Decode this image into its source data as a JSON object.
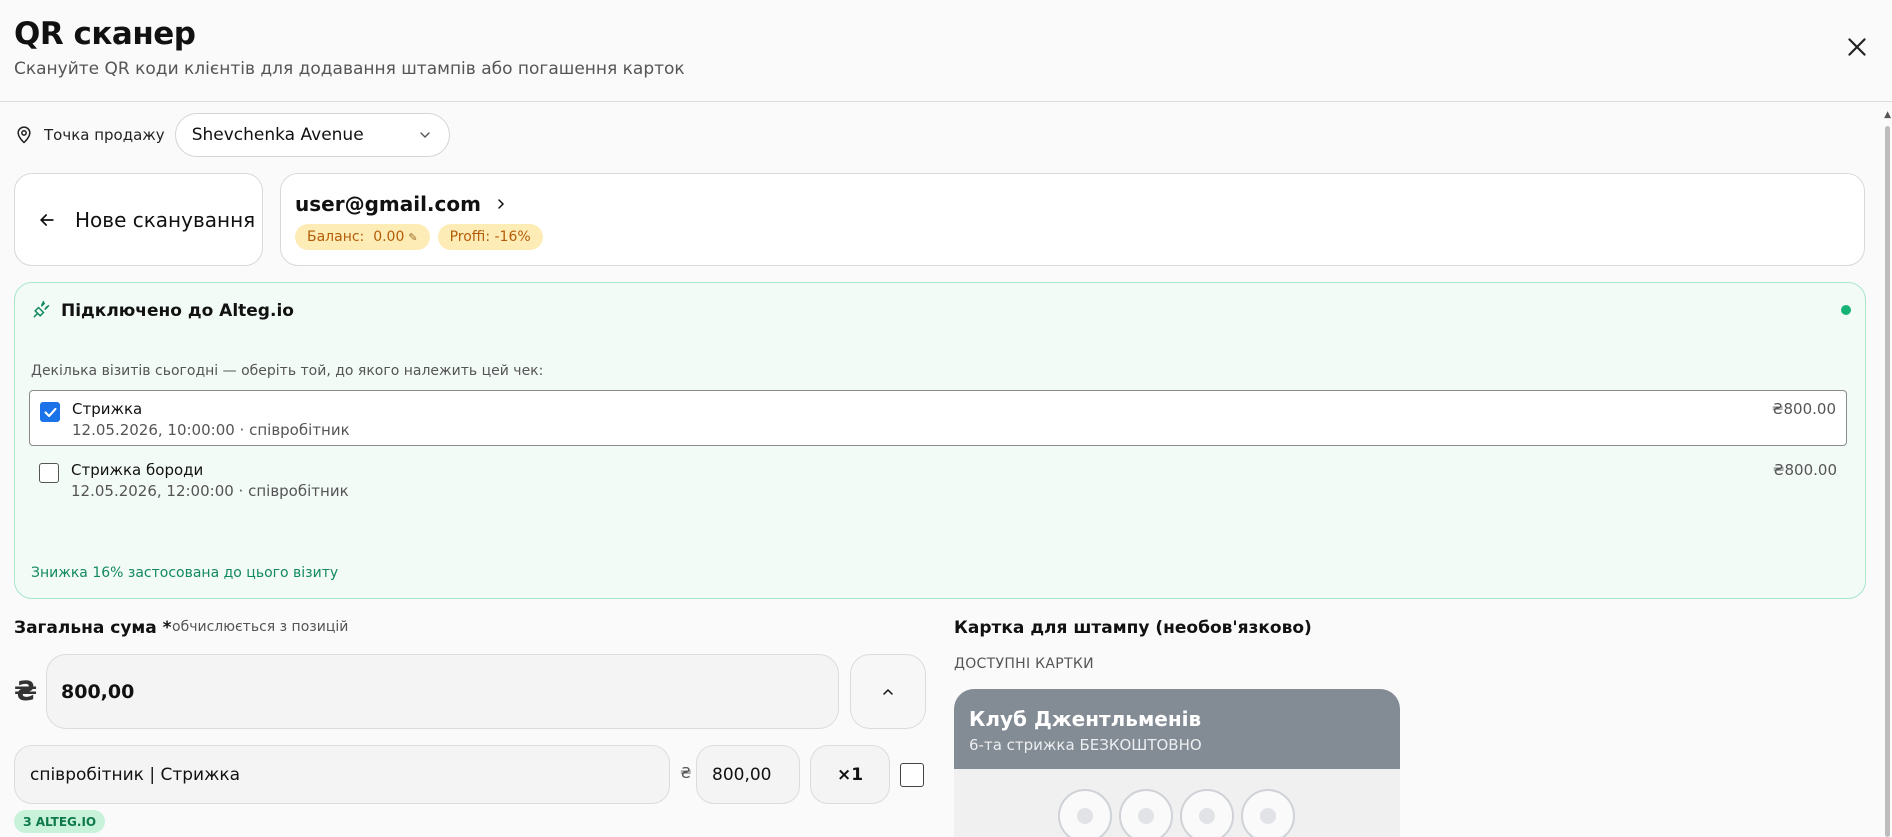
{
  "header": {
    "title": "QR сканер",
    "subtitle": "Скануйте QR коди клієнтів для додавання штампів або погашення карток"
  },
  "point_of_sale": {
    "label": "Точка продажу",
    "selected": "Shevchenka Avenue"
  },
  "back": {
    "label": "Нове сканування"
  },
  "customer": {
    "email": "user@gmail.com",
    "balance_label": "Баланс:",
    "balance_value": "0.00",
    "tier_badge": "Proffi: -16%"
  },
  "alteg": {
    "title": "Підключено до Alteg.io",
    "hint": "Декілька візитів сьогодні — оберіть той, до якого належить цей чек:",
    "visits": [
      {
        "name": "Стрижка",
        "meta": "12.05.2026, 10:00:00 · співробітник",
        "price": "₴800.00",
        "checked": true
      },
      {
        "name": "Стрижка бороди",
        "meta": "12.05.2026, 12:00:00 · співробітник",
        "price": "₴800.00",
        "checked": false
      }
    ],
    "discount_note": "Знижка 16% застосована до цього візиту"
  },
  "total": {
    "label": "Загальна сума *",
    "hint": "обчислюється з позицій",
    "currency_symbol": "₴",
    "value": "800,00"
  },
  "line_item": {
    "name": "співробітник | Стрижка",
    "currency": "₴",
    "price": "800,00",
    "qty": "×1",
    "source_tag": "З ALTEG.IO"
  },
  "stamp_card": {
    "title": "Картка для штампу (необов'язково)",
    "available_label": "ДОСТУПНІ КАРТКИ",
    "cards": [
      {
        "name": "Клуб Джентльменів",
        "description": "6-та стрижка БЕЗКОШТОВНО"
      }
    ]
  },
  "colors": {
    "accent_green": "#16b377",
    "badge_bg": "#fdecb5",
    "checkbox_blue": "#1a73e8",
    "card_header": "#838b94"
  }
}
